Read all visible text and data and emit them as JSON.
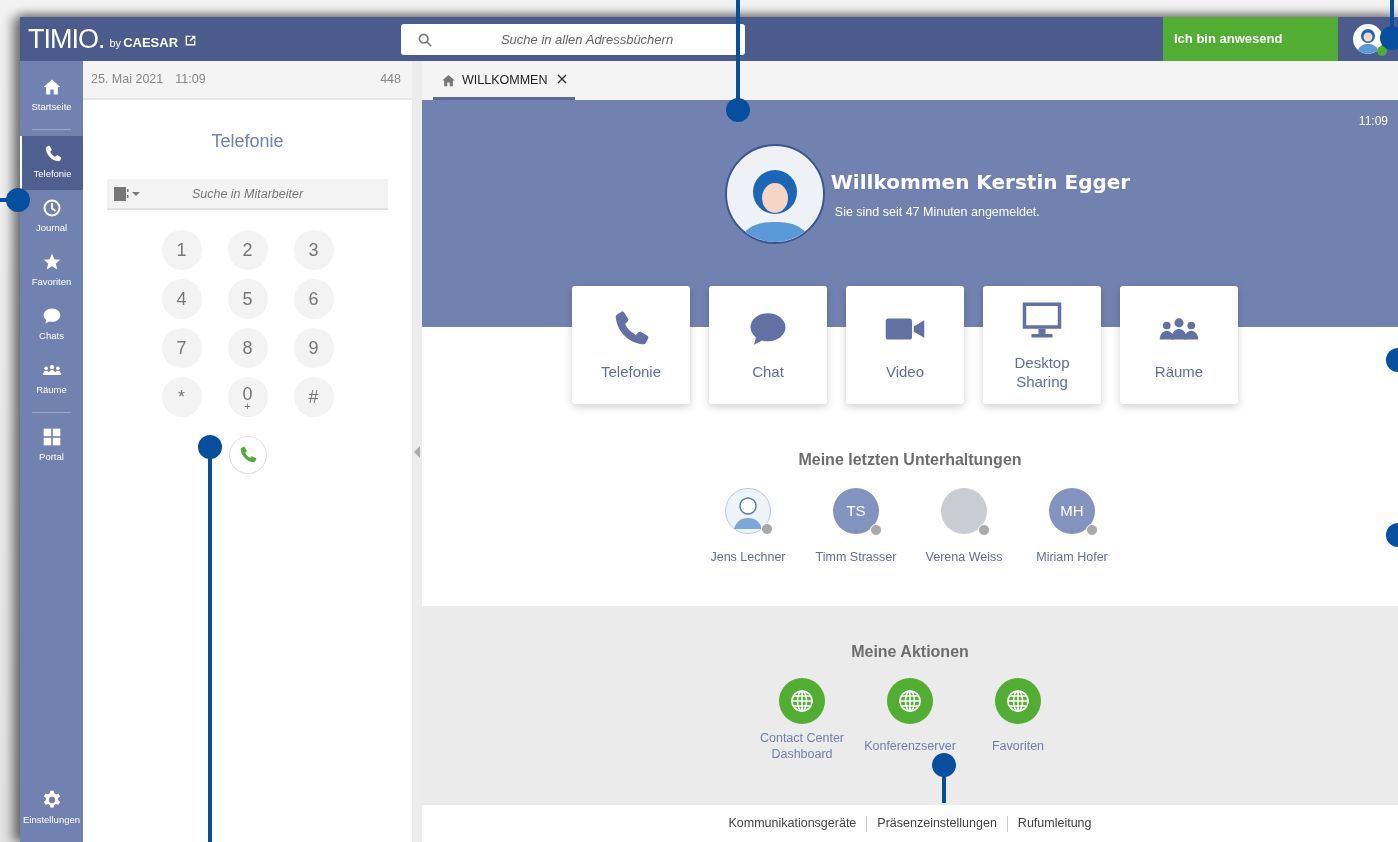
{
  "header": {
    "logo": "TIMIO.",
    "logo_by": "by",
    "logo_brand": "CAESAR",
    "search": {
      "placeholder": "Suche in allen Adressbüchern"
    },
    "status_button": "Ich bin anwesend",
    "user_status": {
      "color": "#52ae32"
    }
  },
  "sidebar": {
    "groups": [
      [
        {
          "label": "Startseite",
          "kind": "home",
          "selected": false
        }
      ],
      [
        {
          "label": "Telefonie",
          "kind": "phone",
          "selected": true
        },
        {
          "label": "Journal",
          "kind": "clock",
          "selected": false
        },
        {
          "label": "Favoriten",
          "kind": "star",
          "selected": false
        },
        {
          "label": "Chats",
          "kind": "chat",
          "selected": false
        },
        {
          "label": "Räume",
          "kind": "people",
          "selected": false
        }
      ],
      [
        {
          "label": "Portal",
          "kind": "grid",
          "selected": false
        }
      ]
    ],
    "footer_item": {
      "label": "Einstellungen",
      "kind": "gear"
    }
  },
  "left_panel": {
    "date": "25. Mai 2021",
    "time": "11:09",
    "extension": "448",
    "title": "Telefonie",
    "search": {
      "placeholder": "Suche in Mitarbeiter"
    },
    "keypad": [
      {
        "digit": "1"
      },
      {
        "digit": "2"
      },
      {
        "digit": "3"
      },
      {
        "digit": "4"
      },
      {
        "digit": "5"
      },
      {
        "digit": "6"
      },
      {
        "digit": "7"
      },
      {
        "digit": "8"
      },
      {
        "digit": "9"
      },
      {
        "digit": "*"
      },
      {
        "digit": "0",
        "sub": "+"
      },
      {
        "digit": "#"
      }
    ]
  },
  "tabs": [
    {
      "label": "WILLKOMMEN",
      "selected": true
    }
  ],
  "welcome": {
    "time": "11:09",
    "heading": "Willkommen Kerstin Egger",
    "subtitle": "Sie sind seit 47 Minuten angemeldet.",
    "tiles": [
      {
        "label": "Telefonie",
        "kind": "phone"
      },
      {
        "label": "Chat",
        "kind": "chat"
      },
      {
        "label": "Video",
        "kind": "video"
      },
      {
        "label": "Desktop Sharing",
        "kind": "monitor"
      },
      {
        "label": "Räume",
        "kind": "people"
      }
    ]
  },
  "recent": {
    "title": "Meine letzten Unterhaltungen",
    "contacts": [
      {
        "name": "Jens Lechner",
        "kind": "illustration",
        "color": "#a9a9a9"
      },
      {
        "name": "Timm Strasser",
        "kind": "initials",
        "initials": "TS",
        "color": "#a9a9a9"
      },
      {
        "name": "Verena Weiss",
        "kind": "photo",
        "color": "#a9a9a9"
      },
      {
        "name": "Miriam Hofer",
        "kind": "initials",
        "initials": "MH",
        "color": "#a9a9a9"
      }
    ]
  },
  "actions": {
    "title": "Meine Aktionen",
    "items": [
      {
        "label": "Contact Center Dashboard"
      },
      {
        "label": "Konferenzserver"
      },
      {
        "label": "Favoriten"
      }
    ]
  },
  "footer_links": [
    "Kommunikationsgeräte",
    "Präsenzeinstellungen",
    "Rufumleitung"
  ]
}
